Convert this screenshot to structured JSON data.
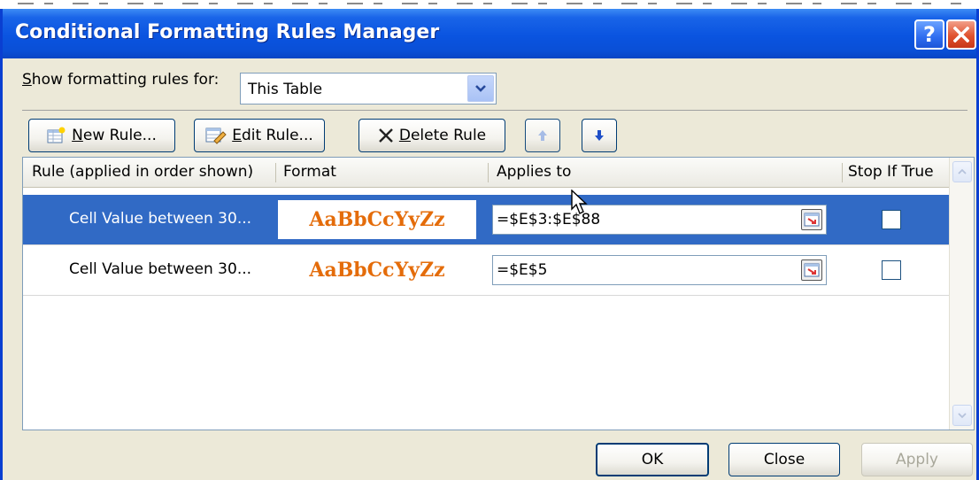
{
  "window": {
    "title": "Conditional Formatting Rules Manager",
    "help_glyph": "?"
  },
  "show_rules": {
    "label_prefix": "S",
    "label_rest": "how formatting rules for:",
    "selected": "This Table"
  },
  "toolbar": {
    "new_rule_underline": "N",
    "new_rule_rest": "ew Rule...",
    "edit_rule_underline": "E",
    "edit_rule_rest": "dit Rule...",
    "delete_rule_underline": "D",
    "delete_rule_rest": "elete Rule"
  },
  "columns": [
    "Rule (applied in order shown)",
    "Format",
    "Applies to",
    "Stop If True"
  ],
  "rules": [
    {
      "rule": "Cell Value between 30...",
      "format_preview": "AaBbCcYyZz",
      "applies_to": "=$E$3:$E$88",
      "stop_if_true": false,
      "selected": true
    },
    {
      "rule": "Cell Value between 30...",
      "format_preview": "AaBbCcYyZz",
      "applies_to": "=$E$5",
      "stop_if_true": false,
      "selected": false
    }
  ],
  "footer": {
    "ok": "OK",
    "close": "Close",
    "apply": "Apply"
  },
  "colors": {
    "title_bar": "#0a54e0",
    "selection": "#316ac5",
    "format_preview_text": "#e46c0a"
  }
}
